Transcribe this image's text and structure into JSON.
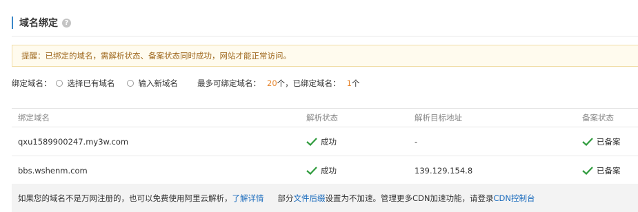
{
  "section": {
    "title": "域名绑定",
    "help_icon": "?"
  },
  "notice": {
    "text": "提醒：已绑定的域名，需解析状态、备案状态同时成功，网站才能正常访问。"
  },
  "bind": {
    "label": "绑定域名：",
    "options": [
      {
        "label": "选择已有域名",
        "selected": false
      },
      {
        "label": "输入新域名",
        "selected": false
      }
    ],
    "max_label": "最多可绑定域名：",
    "max_value": "20",
    "max_unit": "个，已绑定域名：",
    "bound_value": "1",
    "bound_unit": "个"
  },
  "table": {
    "headers": [
      "绑定域名",
      "解析状态",
      "解析目标地址",
      "备案状态"
    ],
    "rows": [
      {
        "domain": "qxu1589900247.my3w.com",
        "dns_status": "成功",
        "target": "-",
        "icp_status": "已备案"
      },
      {
        "domain": "bbs.wshenm.com",
        "dns_status": "成功",
        "target": "139.129.154.8",
        "icp_status": "已备案"
      }
    ]
  },
  "footer": {
    "text1": "如果您的域名不是万网注册的，也可以免费使用阿里云解析，",
    "link1": "了解详情",
    "text2": "部分",
    "link2": "文件后缀",
    "text3": "设置为不加速。管理更多CDN加速功能，请登录",
    "link3": "CDN控制台"
  },
  "colors": {
    "accent": "#3a87c8",
    "success": "#2e9b3c",
    "link": "#1a6bbd",
    "highlight": "#e6852e"
  }
}
